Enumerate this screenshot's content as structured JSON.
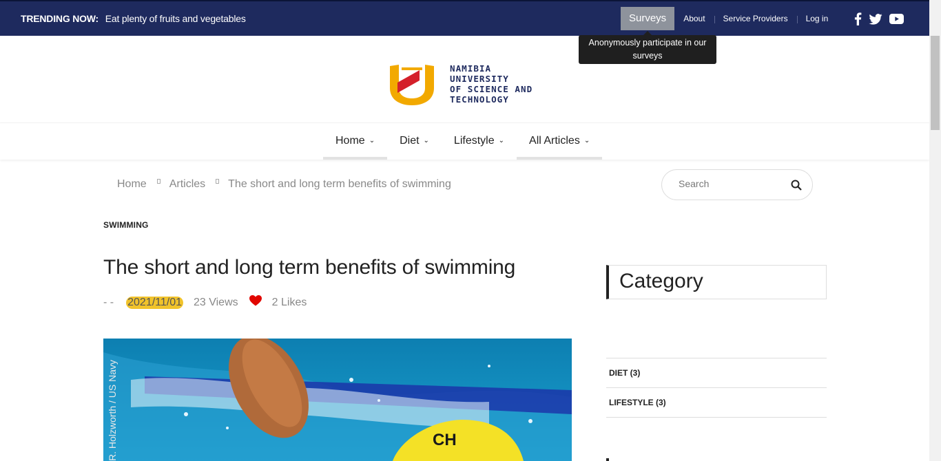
{
  "topbar": {
    "trending_lead": "TRENDING NOW:",
    "trending_text": "Eat plenty of fruits and vegetables",
    "surveys_label": "Surveys",
    "about_label": "About",
    "service_providers_label": "Service Providers",
    "login_label": "Log in",
    "social_icons": [
      "facebook-icon",
      "twitter-icon",
      "youtube-icon"
    ],
    "tooltip": "Anonymously participate in our surveys"
  },
  "logo": {
    "lines": [
      "NAMIBIA",
      "UNIVERSITY",
      "OF SCIENCE AND",
      "TECHNOLOGY"
    ]
  },
  "mainnav": {
    "items": [
      {
        "label": "Home"
      },
      {
        "label": "Diet"
      },
      {
        "label": "Lifestyle"
      },
      {
        "label": "All Articles"
      }
    ]
  },
  "breadcrumb": {
    "items": [
      "Home",
      "Articles",
      "The short and long term benefits of swimming"
    ]
  },
  "search": {
    "placeholder": "Search"
  },
  "article": {
    "category": "SWIMMING",
    "title": "The short and long term benefits of swimming",
    "author_placeholder": "- -",
    "date": "2021/11/01",
    "views": "23 Views",
    "likes": "2 Likes",
    "image_credit": "R. Holzworth / US Navy"
  },
  "sidebar": {
    "title": "Category",
    "categories": [
      {
        "label": "DIET (3)"
      },
      {
        "label": "LIFESTYLE (3)"
      }
    ]
  },
  "colors": {
    "topbar_bg": "#1e2a5e",
    "accent_yellow": "#f1c32b",
    "heart_red": "#e10600"
  }
}
